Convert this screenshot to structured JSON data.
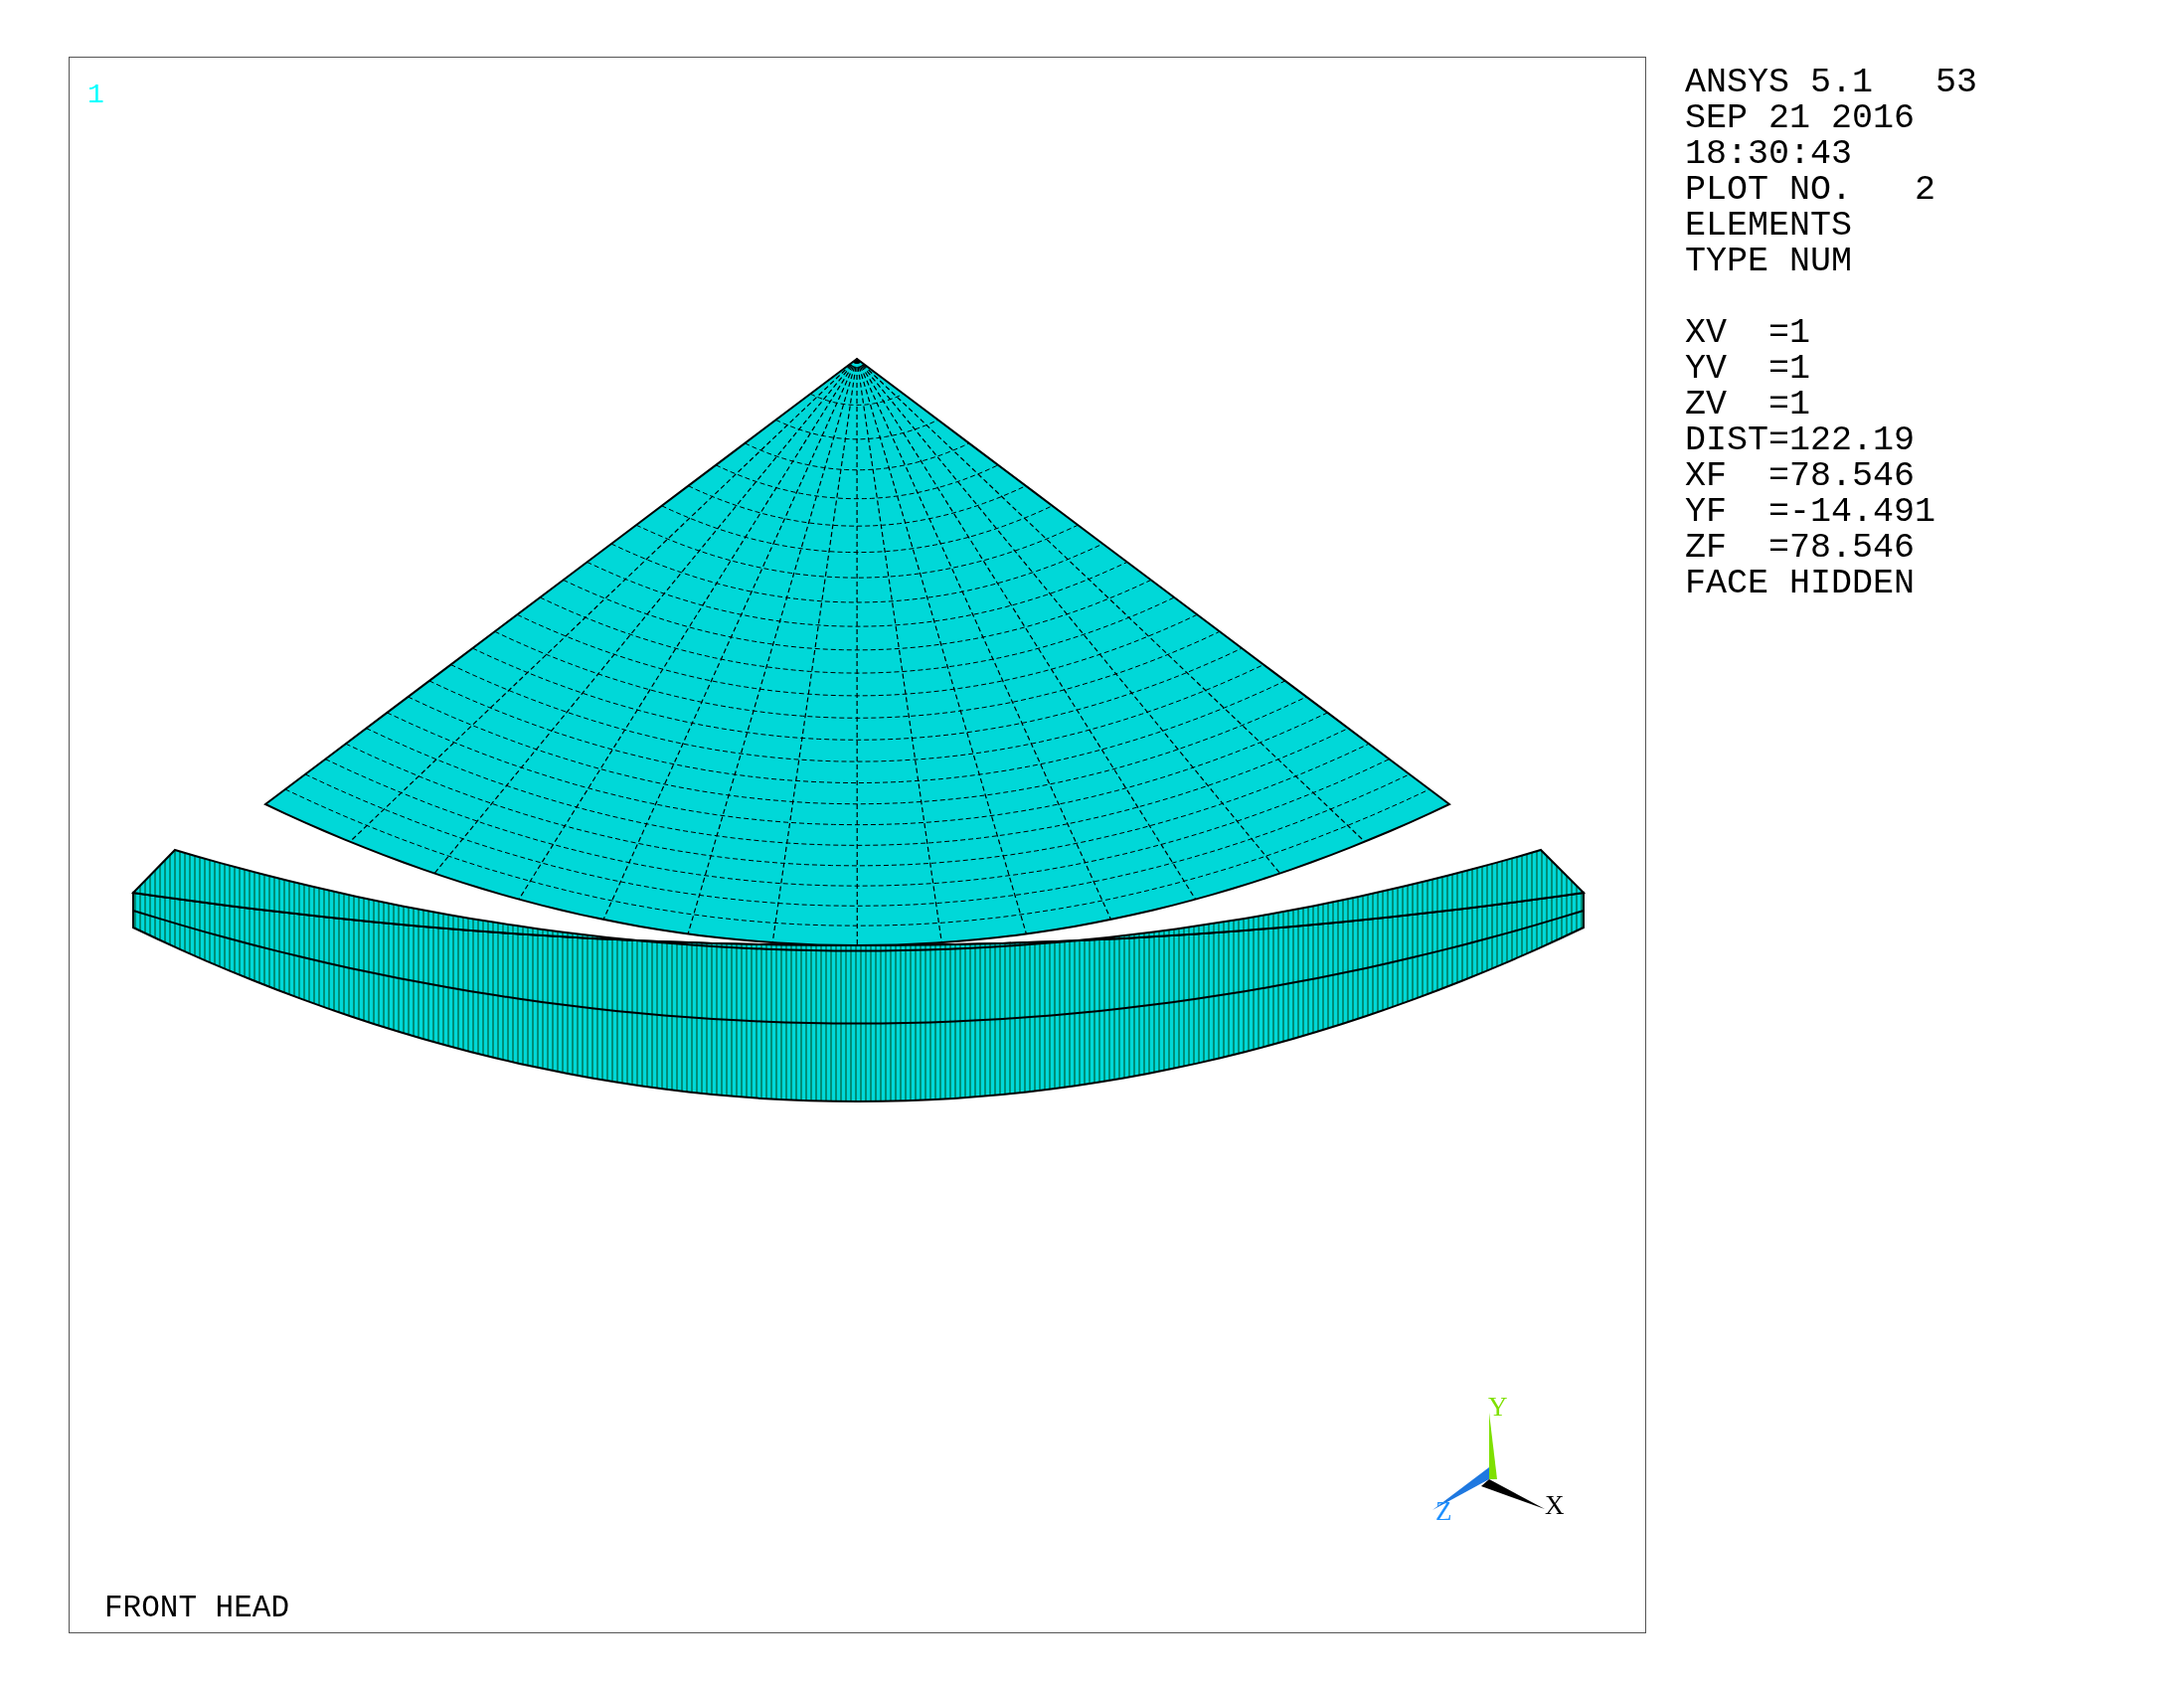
{
  "viewport": {
    "number": "1",
    "title": "FRONT HEAD",
    "triad": {
      "x": "X",
      "y": "Y",
      "z": "Z"
    }
  },
  "info_blocks": [
    [
      "ANSYS 5.1   53",
      "SEP 21 2016",
      "18:30:43",
      "PLOT NO.   2",
      "ELEMENTS",
      "TYPE NUM"
    ],
    [
      "XV  =1",
      "YV  =1",
      "ZV  =1",
      "DIST=122.19",
      "XF  =78.546",
      "YF  =-14.491",
      "ZF  =78.546",
      "FACE HIDDEN"
    ]
  ]
}
